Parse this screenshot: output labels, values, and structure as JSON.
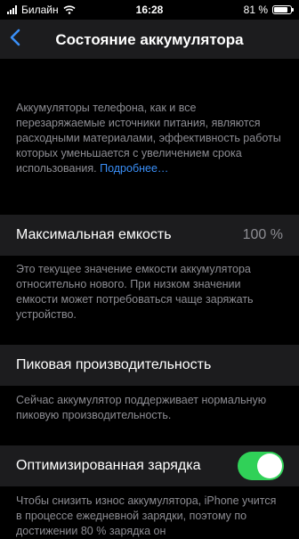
{
  "status_bar": {
    "carrier": "Билайн",
    "time": "16:28",
    "battery_percent": "81 %",
    "battery_level": 0.81
  },
  "nav": {
    "back_icon": "chevron-left-icon",
    "title": "Состояние аккумулятора"
  },
  "intro": {
    "text": "Аккумуляторы телефона, как и все перезаряжаемые источники питания, являются расходными материалами, эффективность работы которых уменьшается с увеличением срока использования.",
    "link": "Подробнее…"
  },
  "max_capacity": {
    "label": "Максимальная емкость",
    "value": "100 %",
    "footer": "Это текущее значение емкости аккумулятора относительно нового. При низком значении емкости может потребоваться чаще заряжать устройство."
  },
  "peak_performance": {
    "label": "Пиковая производительность",
    "footer": "Сейчас аккумулятор поддерживает нормальную пиковую производительность."
  },
  "optimized_charging": {
    "label": "Оптимизированная зарядка",
    "enabled": true,
    "footer": "Чтобы снизить износ аккумулятора, iPhone учится в процессе ежедневной зарядки, поэтому по достижении 80 % зарядка он"
  },
  "colors": {
    "accent": "#3a8ff7",
    "toggle_on": "#30d158",
    "cell_bg": "#1c1c1e",
    "secondary_text": "#8d8d93"
  }
}
